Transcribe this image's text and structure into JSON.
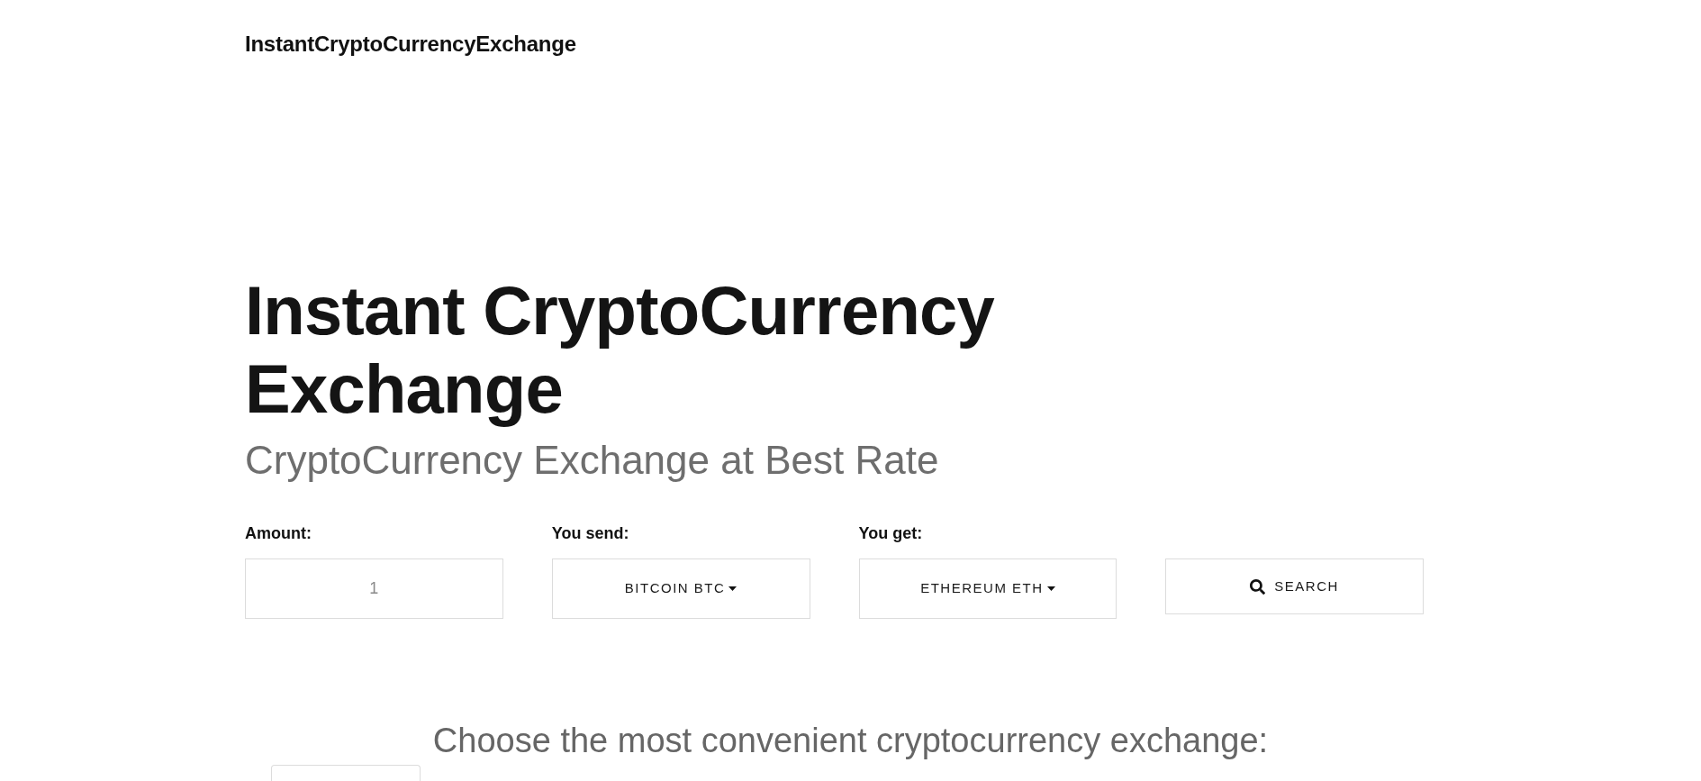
{
  "header": {
    "brand": "InstantCryptoCurrencyExchange"
  },
  "hero": {
    "title": "Instant CryptoCurrency Exchange",
    "subtitle": "CryptoCurrency Exchange at Best Rate"
  },
  "form": {
    "fields": [
      {
        "kind": "input",
        "label": "Amount:",
        "value": "1"
      },
      {
        "kind": "dropdown",
        "label": "You send:",
        "value": "BITCOIN BTC"
      },
      {
        "kind": "dropdown",
        "label": "You get:",
        "value": "ETHEREUM ETH"
      }
    ],
    "search_button": {
      "label": "SEARCH"
    }
  },
  "exchanges": {
    "heading": "Choose the most convenient cryptocurrency exchange:"
  }
}
